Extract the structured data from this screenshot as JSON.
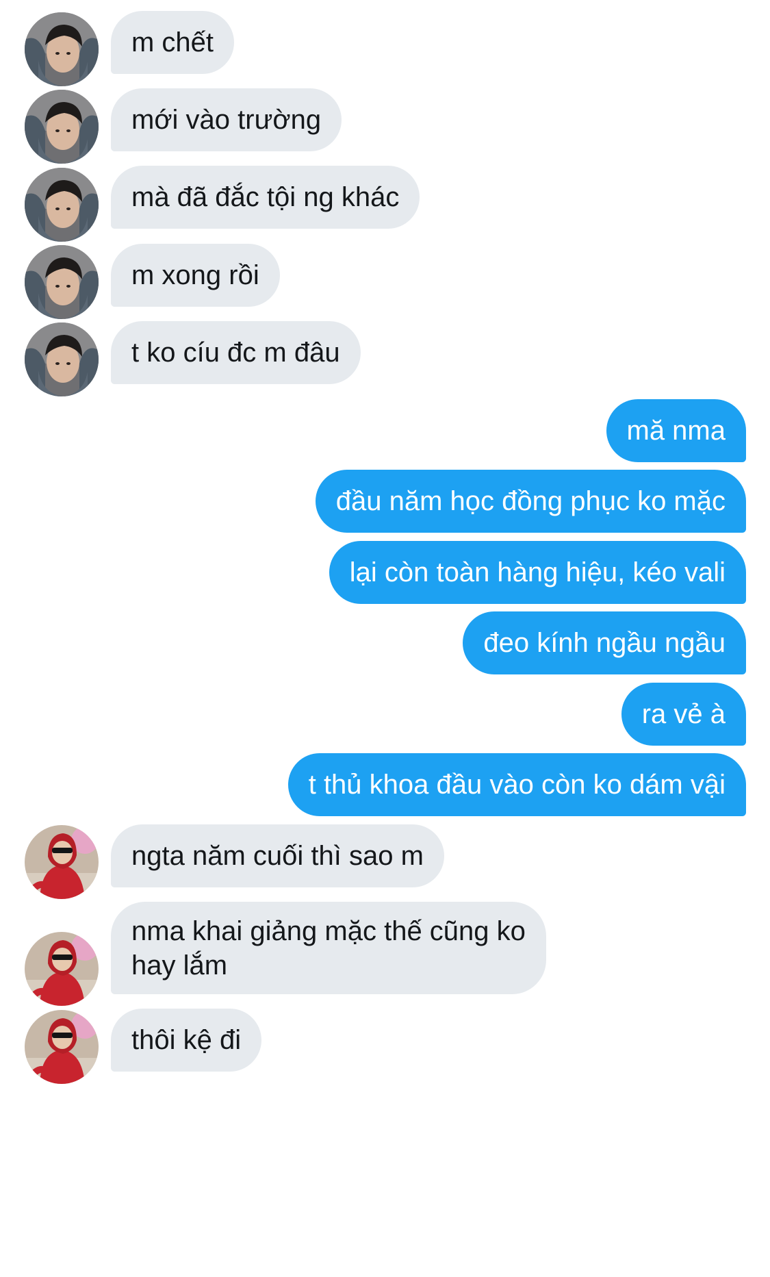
{
  "conversation": {
    "messages": [
      {
        "from": "other",
        "avatar": "avatar-boy",
        "text": "m chết"
      },
      {
        "from": "other",
        "avatar": "avatar-boy",
        "text": "mới vào trường"
      },
      {
        "from": "other",
        "avatar": "avatar-boy",
        "text": "mà đã đắc tội ng khác"
      },
      {
        "from": "other",
        "avatar": "avatar-boy",
        "text": "m xong rồi"
      },
      {
        "from": "other",
        "avatar": "avatar-boy",
        "text": "t ko cíu đc m đâu"
      },
      {
        "from": "me",
        "text": "mă nma"
      },
      {
        "from": "me",
        "text": "đầu năm học đồng phục ko mặc"
      },
      {
        "from": "me",
        "text": "lại còn toàn hàng hiệu, kéo vali"
      },
      {
        "from": "me",
        "text": "đeo kính ngầu ngầu"
      },
      {
        "from": "me",
        "text": "ra vẻ à"
      },
      {
        "from": "me",
        "text": "t thủ khoa đầu vào còn ko dám vậi"
      },
      {
        "from": "other",
        "avatar": "avatar-red-hoodie",
        "text": "ngta năm cuối thì sao m"
      },
      {
        "from": "other",
        "avatar": "avatar-red-hoodie",
        "text_line1": "nma khai giảng mặc thế cũng ko",
        "text_line2": "hay lắm"
      },
      {
        "from": "other",
        "avatar": "avatar-red-hoodie",
        "text": "thôi kệ đi"
      }
    ]
  },
  "colors": {
    "incoming_bubble": "#e6eaee",
    "incoming_text": "#14171a",
    "outgoing_bubble": "#1da1f2",
    "outgoing_text": "#ffffff"
  }
}
